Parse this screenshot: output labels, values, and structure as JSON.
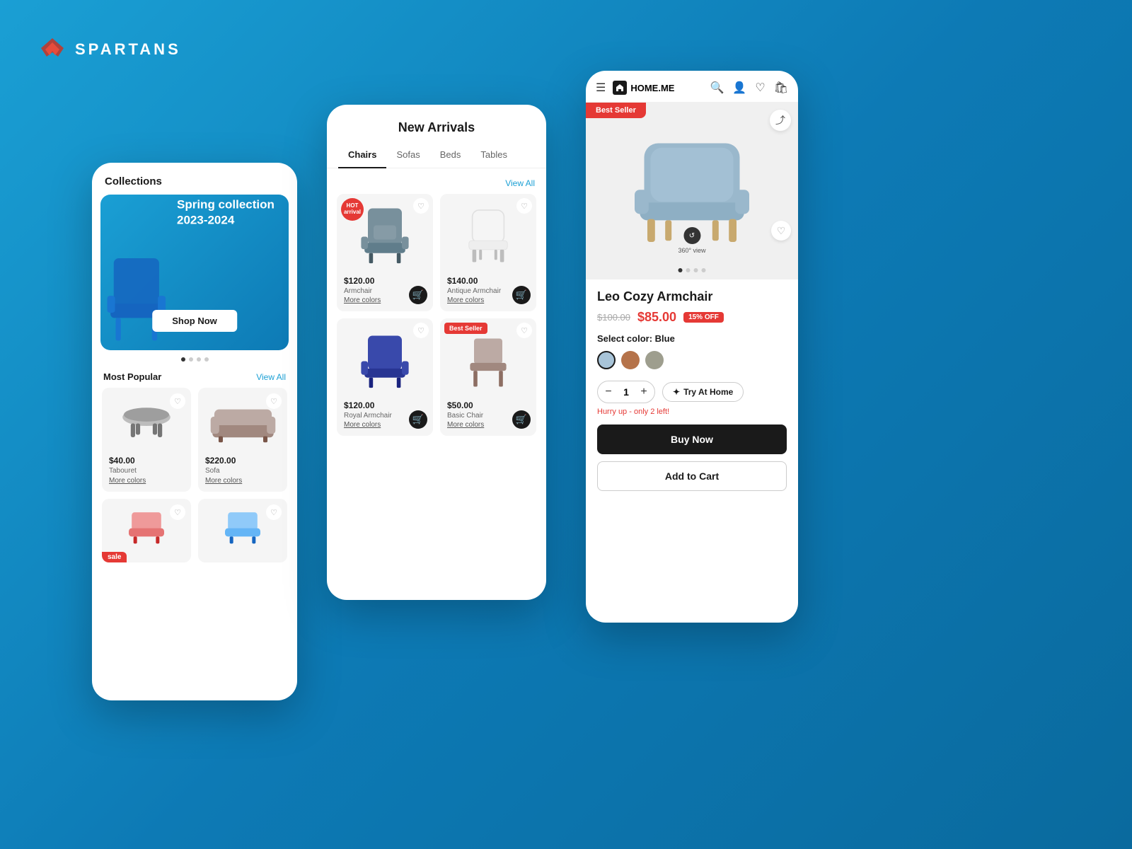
{
  "brand": {
    "name": "SPARTANS"
  },
  "phone1": {
    "header": "Collections",
    "banner": {
      "title": "Spring collection",
      "subtitle": "2023-2024",
      "button": "Shop Now"
    },
    "section": "Most Popular",
    "view_all": "View All",
    "products": [
      {
        "price": "$40.00",
        "name": "Tabouret",
        "more": "More colors"
      },
      {
        "price": "$220.00",
        "name": "Sofa",
        "more": "More colors"
      },
      {
        "price": "",
        "name": "",
        "badge": "sale"
      },
      {
        "price": "",
        "name": ""
      }
    ]
  },
  "phone2": {
    "title": "New Arrivals",
    "tabs": [
      "Chairs",
      "Sofas",
      "Beds",
      "Tables"
    ],
    "active_tab": "Chairs",
    "view_all": "View All",
    "products": [
      {
        "price": "$120.00",
        "name": "Armchair",
        "more": "More colors",
        "hot": true
      },
      {
        "price": "$140.00",
        "name": "Antique Armchair",
        "more": "More colors"
      },
      {
        "price": "$120.00",
        "name": "Royal Armchair",
        "more": "More colors"
      },
      {
        "price": "$50.00",
        "name": "Basic Chair",
        "more": "More colors",
        "best_seller": true
      }
    ]
  },
  "phone3": {
    "brand_name": "HOME.ME",
    "best_seller": "Best Seller",
    "product_name": "Leo Cozy Armchair",
    "original_price": "$100.00",
    "sale_price": "$85.00",
    "discount": "15% OFF",
    "color_label": "Select color:",
    "color_value": "Blue",
    "colors": [
      "#a8c4d8",
      "#b5734a",
      "#9e9e8e"
    ],
    "quantity": "1",
    "try_home": "Try At Home",
    "view360": "360° view",
    "hurry": "Hurry up - only 2 left!",
    "buy_now": "Buy Now",
    "add_to_cart": "Add to Cart"
  }
}
